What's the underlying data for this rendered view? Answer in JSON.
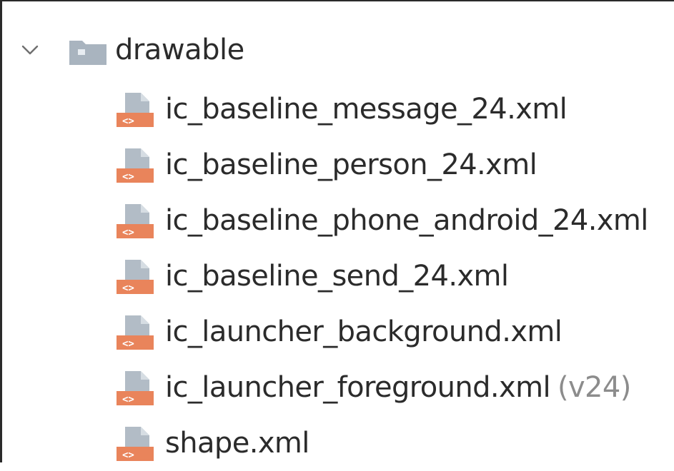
{
  "tree": {
    "folder": {
      "label": "drawable",
      "expanded": true,
      "icon": "folder-icon",
      "icon_color": "#a9b4bf"
    },
    "file_icon": "xml-file-icon",
    "file_icon_color": "#e9845b",
    "files": [
      {
        "name": "ic_baseline_message_24.xml",
        "qualifier": ""
      },
      {
        "name": "ic_baseline_person_24.xml",
        "qualifier": ""
      },
      {
        "name": "ic_baseline_phone_android_24.xml",
        "qualifier": ""
      },
      {
        "name": "ic_baseline_send_24.xml",
        "qualifier": ""
      },
      {
        "name": "ic_launcher_background.xml",
        "qualifier": ""
      },
      {
        "name": "ic_launcher_foreground.xml",
        "qualifier": "(v24)"
      },
      {
        "name": "shape.xml",
        "qualifier": ""
      }
    ]
  }
}
